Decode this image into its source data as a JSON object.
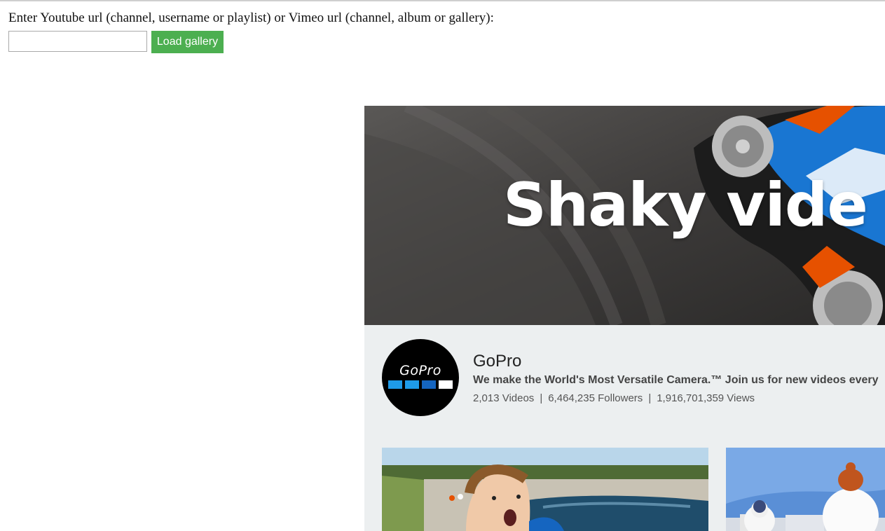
{
  "form": {
    "prompt": "Enter Youtube url (channel, username or playlist) or Vimeo url (channel, album or gallery):",
    "input_value": "",
    "input_placeholder": "",
    "button_label": "Load gallery"
  },
  "gallery": {
    "banner_text": "Shaky vide",
    "channel": {
      "name": "GoPro",
      "description": "We make the World's Most Versatile Camera.™ Join us for new videos every",
      "avatar_logo_text": "GoPro",
      "stats": {
        "videos": "2,013 Videos",
        "followers": "6,464,235 Followers",
        "views": "1,916,701,359 Views",
        "separator": "|"
      }
    },
    "thumbnails": [
      {
        "subject": "child-in-pool"
      },
      {
        "subject": "snowman"
      }
    ]
  },
  "colors": {
    "button_bg": "#4caf50",
    "gallery_bg": "#eceff0",
    "brand_blue": "#1e9be9"
  }
}
